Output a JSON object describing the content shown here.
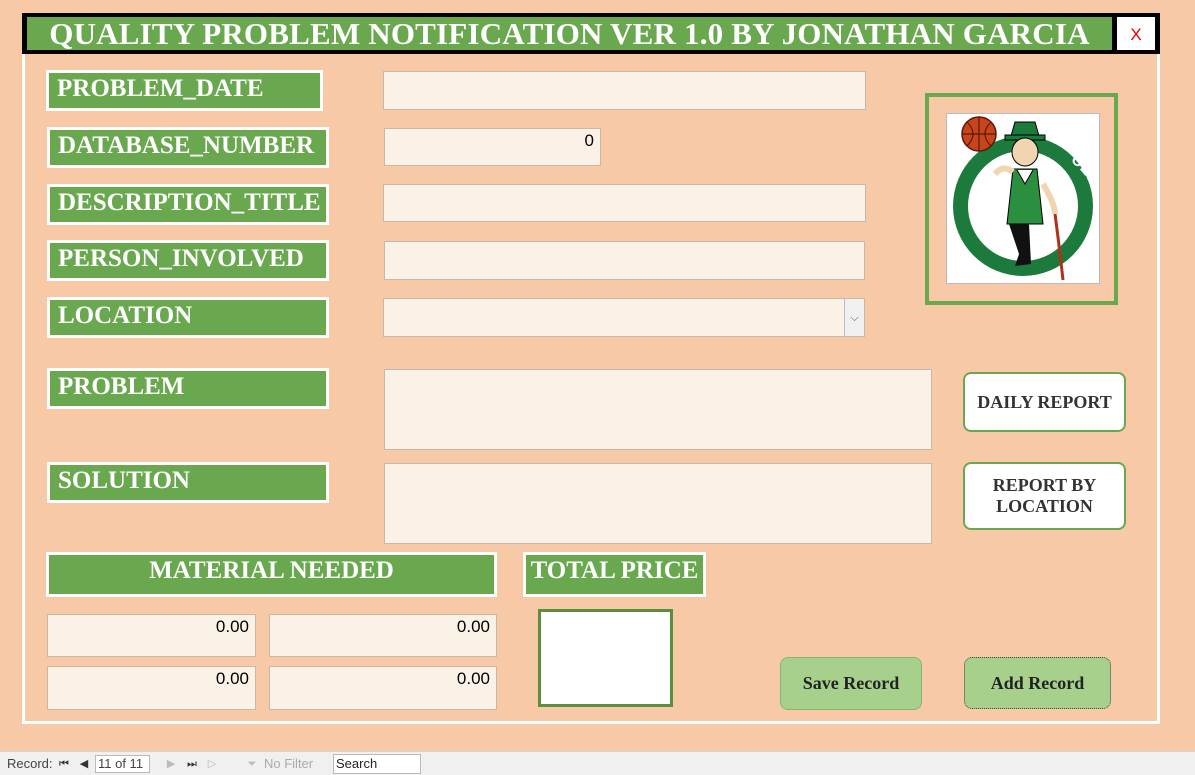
{
  "window": {
    "title": "QUALITY PROBLEM NOTIFICATION VER 1.0 BY JONATHAN GARCIA",
    "close_label": "X"
  },
  "labels": {
    "problem_date": "PROBLEM_DATE",
    "database_number": "DATABASE_NUMBER",
    "description_title": "DESCRIPTION_TITLE",
    "person_involved": "PERSON_INVOLVED",
    "location": "LOCATION",
    "problem": "PROBLEM",
    "solution": "SOLUTION",
    "material_needed": "MATERIAL NEEDED",
    "total_price": "TOTAL PRICE"
  },
  "fields": {
    "problem_date": "",
    "database_number": "0",
    "description_title": "",
    "person_involved": "",
    "location": "",
    "problem": "",
    "solution": "",
    "material": [
      "0.00",
      "0.00",
      "0.00",
      "0.00"
    ],
    "total_price": ""
  },
  "logo": {
    "name": "boston-celtics-logo",
    "text_left": "BOSTON",
    "text_right": "CELTICS"
  },
  "buttons": {
    "daily_report": "DAILY REPORT",
    "report_by_location_line1": "REPORT BY",
    "report_by_location_line2": "LOCATION",
    "save_record": "Save Record",
    "add_record": "Add Record"
  },
  "status_bar": {
    "record_label": "Record:",
    "record_position": "11 of 11",
    "filter_label": "No Filter",
    "search_placeholder": "Search"
  },
  "colors": {
    "background": "#f8c9a6",
    "label_green": "#6aa84f",
    "button_green": "#a8d08d",
    "close_red": "#ee0000"
  }
}
